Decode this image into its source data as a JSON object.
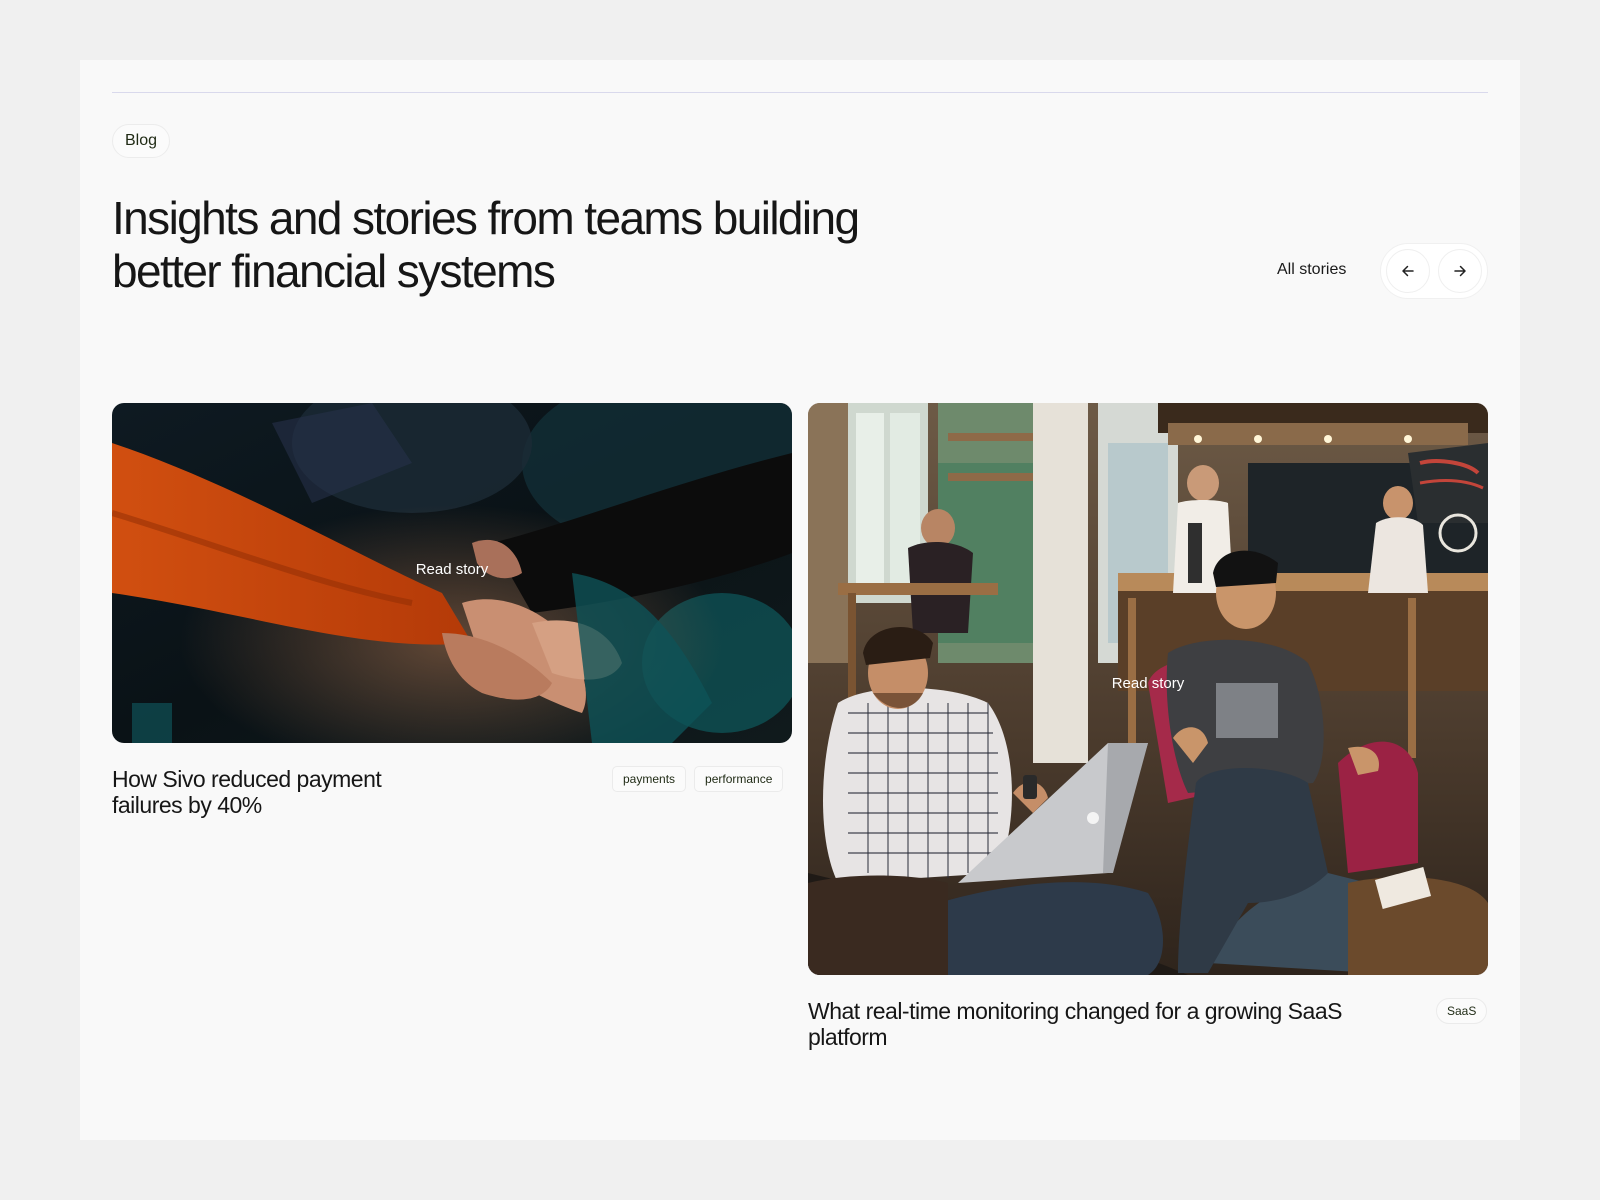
{
  "section": {
    "label": "Blog",
    "headline_line1": "Insights and stories from teams building",
    "headline_line2": "better financial systems",
    "all_stories_label": "All stories",
    "prev_icon": "arrow-left-icon",
    "next_icon": "arrow-right-icon"
  },
  "stories": [
    {
      "title_line1": "How Sivo reduced payment",
      "title_line2": "failures by 40%",
      "cta": "Read story",
      "image": "photo of hands stacked together in a team huddle",
      "tags": [
        "payments",
        "performance"
      ]
    },
    {
      "title_line1": "What real-time monitoring changed for a growing SaaS",
      "title_line2": "platform",
      "cta": "Read story",
      "image": "photo of two men laughing in a cafe with a laptop",
      "tags": [
        "SaaS"
      ]
    }
  ],
  "colors": {
    "page_bg": "#f0f0f0",
    "panel_bg": "#f9f9f9",
    "rule": "#d9d9ec",
    "text": "#161616"
  }
}
